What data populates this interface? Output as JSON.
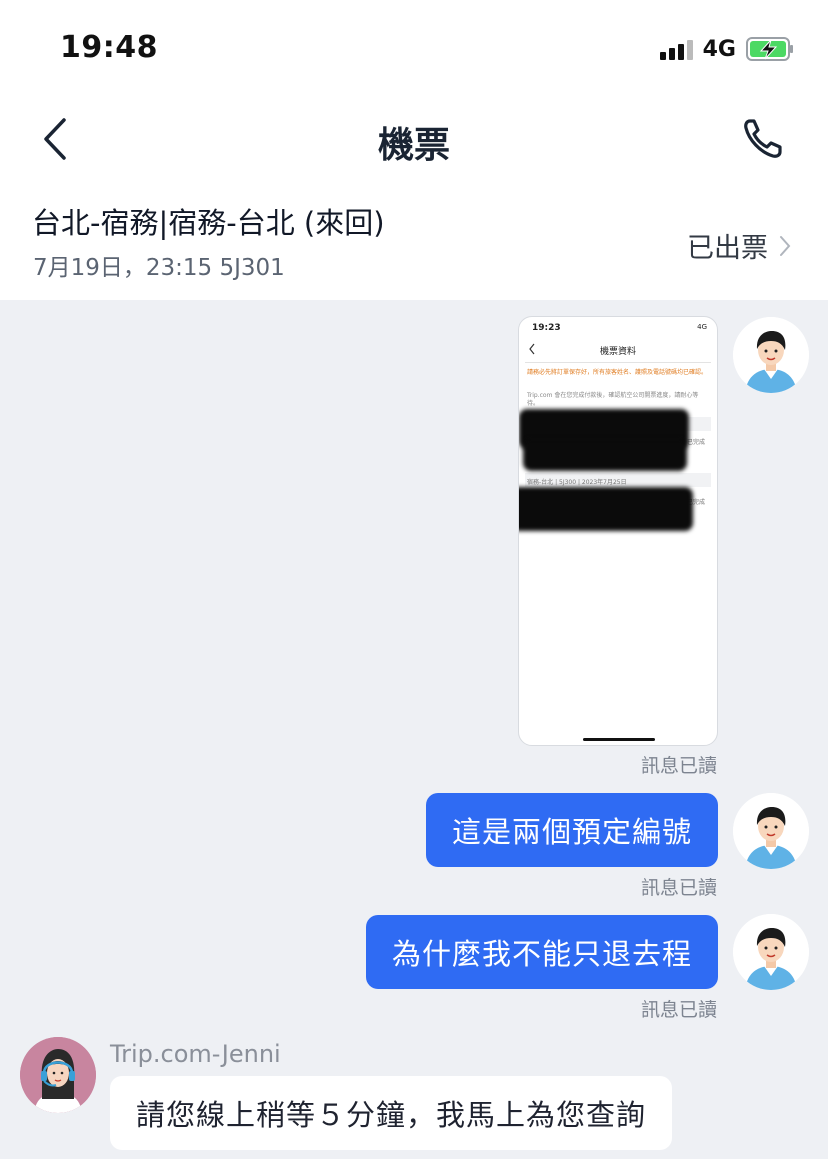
{
  "status_bar": {
    "time": "19:48",
    "network": "4G"
  },
  "nav": {
    "title": "機票",
    "back_icon": "chevron-left-icon",
    "call_icon": "phone-icon"
  },
  "flight": {
    "route": "台北-宿務|宿務-台北 (來回)",
    "date_time_flight": "7月19日，23:15 5J301",
    "ticket_status": "已出票"
  },
  "messages": [
    {
      "type": "image",
      "sender": "user",
      "read_status": "訊息已讀",
      "image": {
        "time": "19:23",
        "signal": "4G",
        "title": "機票資料",
        "notice": "請務必先將訂單保存好，所有旅客姓名、護照及電話號碼均已確認。",
        "info": "Trip.com 會在您完成付款後，確認航空公司開票進度，請耐心等待。",
        "row1": "宿務-台北 | 5J300 | 2023年7月25日",
        "row1_note": "已完成"
      }
    },
    {
      "type": "text",
      "sender": "user",
      "text": "這是兩個預定編號",
      "read_status": "訊息已讀"
    },
    {
      "type": "text",
      "sender": "user",
      "text": "為什麼我不能只退去程",
      "read_status": "訊息已讀"
    },
    {
      "type": "text",
      "sender": "agent",
      "name": "Trip.com-Jenni",
      "text": "請您線上稍等５分鐘，我馬上為您查詢"
    }
  ],
  "colors": {
    "accent": "#2f6bf3",
    "background": "#eef0f4",
    "agent_avatar_bg": "#c8859f"
  }
}
